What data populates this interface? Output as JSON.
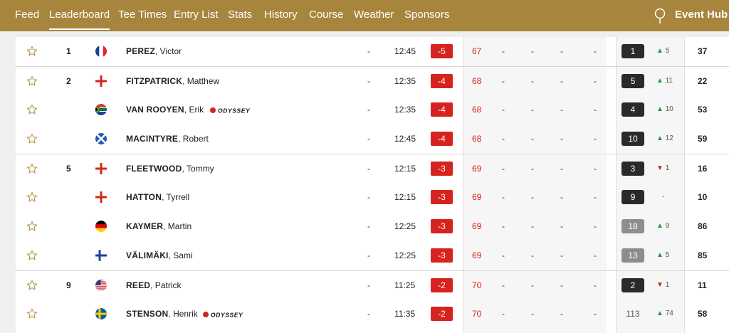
{
  "nav": {
    "items": [
      "Feed",
      "Leaderboard",
      "Tee Times",
      "Entry List",
      "Stats",
      "History",
      "Course",
      "Weather",
      "Sponsors"
    ],
    "active": "Leaderboard",
    "event_hub": "Event Hub"
  },
  "colors": {
    "gold": "#a7853d",
    "red": "#d6231f",
    "green": "#2a9a3a"
  },
  "rows": [
    {
      "pos": "1",
      "flag": "france",
      "last": "PEREZ",
      "first": ", Victor",
      "sponsor": "",
      "thru": "-",
      "tee": "12:45",
      "topar": "-5",
      "r1": "67",
      "r2": "-",
      "r3": "-",
      "r4": "-",
      "total": "-",
      "rank": "1",
      "rank_style": "dark",
      "move_dir": "up",
      "move": "5",
      "last_col": "37"
    },
    {
      "pos": "2",
      "flag": "england",
      "last": "FITZPATRICK",
      "first": ", Matthew",
      "sponsor": "",
      "thru": "-",
      "tee": "12:35",
      "topar": "-4",
      "r1": "68",
      "r2": "-",
      "r3": "-",
      "r4": "-",
      "total": "-",
      "rank": "5",
      "rank_style": "dark",
      "move_dir": "up",
      "move": "11",
      "last_col": "22"
    },
    {
      "pos": "",
      "flag": "south-africa",
      "last": "VAN ROOYEN",
      "first": ", Erik",
      "sponsor": "ODYSSEY",
      "thru": "-",
      "tee": "12:35",
      "topar": "-4",
      "r1": "68",
      "r2": "-",
      "r3": "-",
      "r4": "-",
      "total": "-",
      "rank": "4",
      "rank_style": "dark",
      "move_dir": "up",
      "move": "10",
      "last_col": "53"
    },
    {
      "pos": "",
      "flag": "scotland",
      "last": "MACINTYRE",
      "first": ", Robert",
      "sponsor": "",
      "thru": "-",
      "tee": "12:45",
      "topar": "-4",
      "r1": "68",
      "r2": "-",
      "r3": "-",
      "r4": "-",
      "total": "-",
      "rank": "10",
      "rank_style": "dark",
      "move_dir": "up",
      "move": "12",
      "last_col": "59"
    },
    {
      "pos": "5",
      "flag": "england",
      "last": "FLEETWOOD",
      "first": ", Tommy",
      "sponsor": "",
      "thru": "-",
      "tee": "12:15",
      "topar": "-3",
      "r1": "69",
      "r2": "-",
      "r3": "-",
      "r4": "-",
      "total": "-",
      "rank": "3",
      "rank_style": "dark",
      "move_dir": "down",
      "move": "1",
      "last_col": "16"
    },
    {
      "pos": "",
      "flag": "england",
      "last": "HATTON",
      "first": ", Tyrrell",
      "sponsor": "",
      "thru": "-",
      "tee": "12:15",
      "topar": "-3",
      "r1": "69",
      "r2": "-",
      "r3": "-",
      "r4": "-",
      "total": "-",
      "rank": "9",
      "rank_style": "dark",
      "move_dir": "none",
      "move": "-",
      "last_col": "10"
    },
    {
      "pos": "",
      "flag": "germany",
      "last": "KAYMER",
      "first": ", Martin",
      "sponsor": "",
      "thru": "-",
      "tee": "12:25",
      "topar": "-3",
      "r1": "69",
      "r2": "-",
      "r3": "-",
      "r4": "-",
      "total": "-",
      "rank": "18",
      "rank_style": "grey",
      "move_dir": "up",
      "move": "9",
      "last_col": "86"
    },
    {
      "pos": "",
      "flag": "finland",
      "last": "VÄLIMÄKI",
      "first": ", Sami",
      "sponsor": "",
      "thru": "-",
      "tee": "12:25",
      "topar": "-3",
      "r1": "69",
      "r2": "-",
      "r3": "-",
      "r4": "-",
      "total": "-",
      "rank": "13",
      "rank_style": "grey",
      "move_dir": "up",
      "move": "5",
      "last_col": "85"
    },
    {
      "pos": "9",
      "flag": "usa",
      "last": "REED",
      "first": ", Patrick",
      "sponsor": "",
      "thru": "-",
      "tee": "11:25",
      "topar": "-2",
      "r1": "70",
      "r2": "-",
      "r3": "-",
      "r4": "-",
      "total": "-",
      "rank": "2",
      "rank_style": "dark",
      "move_dir": "down",
      "move": "1",
      "last_col": "11"
    },
    {
      "pos": "",
      "flag": "sweden",
      "last": "STENSON",
      "first": ", Henrik",
      "sponsor": "ODYSSEY",
      "thru": "-",
      "tee": "11:35",
      "topar": "-2",
      "r1": "70",
      "r2": "-",
      "r3": "-",
      "r4": "-",
      "total": "-",
      "rank": "113",
      "rank_style": "plain",
      "move_dir": "up",
      "move": "74",
      "last_col": "58"
    }
  ]
}
